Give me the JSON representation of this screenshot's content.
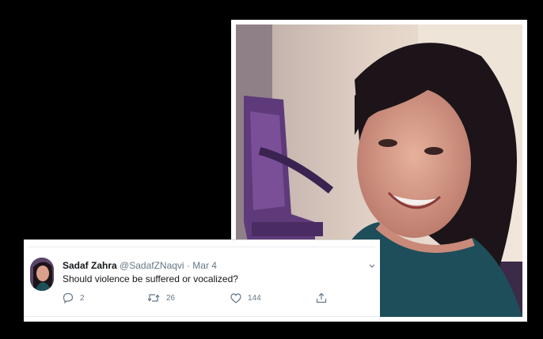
{
  "tweet": {
    "author_name": "Sadaf Zahra",
    "handle": "@SadafZNaqvi",
    "separator": "·",
    "date": "Mar 4",
    "text": "Should violence be suffered or vocalized?",
    "reply_count": "2",
    "retweet_count": "26",
    "like_count": "144"
  },
  "icons": {
    "reply": "reply-icon",
    "retweet": "retweet-icon",
    "like": "heart-icon",
    "share": "share-icon",
    "more": "chevron-down-icon"
  },
  "colors": {
    "background": "#000000",
    "text_primary": "#14171a",
    "text_secondary": "#657786",
    "card": "#ffffff"
  }
}
